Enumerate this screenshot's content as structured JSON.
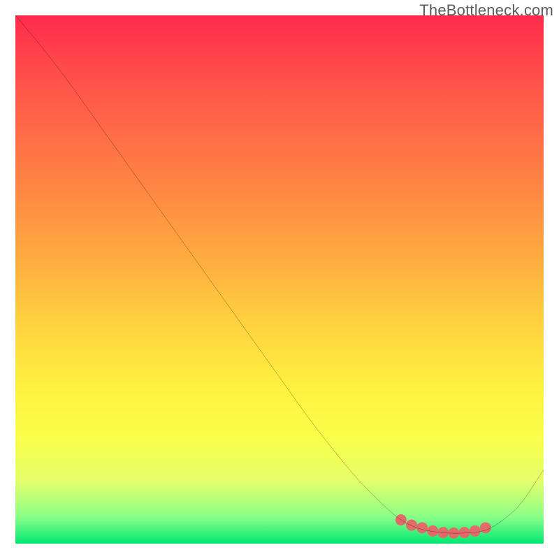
{
  "watermark": "TheBottleneck.com",
  "chart_data": {
    "type": "line",
    "title": "",
    "xlabel": "",
    "ylabel": "",
    "xlim": [
      0,
      100
    ],
    "ylim": [
      0,
      100
    ],
    "series": [
      {
        "name": "bottleneck-curve",
        "x": [
          0,
          5,
          10,
          15,
          20,
          25,
          30,
          35,
          40,
          45,
          50,
          55,
          60,
          65,
          70,
          73,
          76,
          79,
          82,
          85,
          88,
          90,
          93,
          96,
          100
        ],
        "y": [
          100,
          94,
          87.5,
          80.5,
          73.5,
          66.5,
          59.5,
          52.5,
          45.5,
          38.5,
          31.5,
          24.5,
          18,
          12,
          7,
          4.5,
          3,
          2.3,
          2,
          2,
          2.3,
          3,
          5,
          8,
          14
        ],
        "color": "#000000",
        "stroke_width": 2
      },
      {
        "name": "optimal-band-markers",
        "x": [
          73,
          75,
          77,
          79,
          81,
          83,
          85,
          87,
          89
        ],
        "y": [
          4.5,
          3.5,
          3,
          2.4,
          2.1,
          2,
          2.1,
          2.4,
          3
        ],
        "color": "#e46a6a",
        "marker_radius": 8
      }
    ],
    "gradient_stops": [
      {
        "pos": 0.0,
        "color": "#ff2a4d"
      },
      {
        "pos": 0.1,
        "color": "#ff4b4a"
      },
      {
        "pos": 0.22,
        "color": "#ff6b47"
      },
      {
        "pos": 0.34,
        "color": "#ff8a43"
      },
      {
        "pos": 0.46,
        "color": "#ffab40"
      },
      {
        "pos": 0.58,
        "color": "#ffd13f"
      },
      {
        "pos": 0.7,
        "color": "#fff03f"
      },
      {
        "pos": 0.8,
        "color": "#f9ff4a"
      },
      {
        "pos": 0.88,
        "color": "#e6ff6a"
      },
      {
        "pos": 0.95,
        "color": "#89ff88"
      },
      {
        "pos": 1.0,
        "color": "#00e873"
      }
    ]
  }
}
